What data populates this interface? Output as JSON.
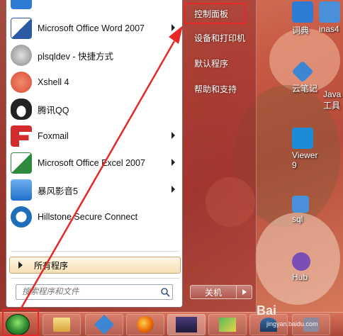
{
  "desktop": {
    "icons": [
      {
        "label": "词典",
        "color": "#2e7bd6"
      },
      {
        "label": "inas4",
        "color": "#4a90d9"
      },
      {
        "label": "云笔记",
        "color": "#3d86d4"
      },
      {
        "label": "Java",
        "color": "#2c5f9a"
      },
      {
        "label": "工具",
        "color": "#2c5f9a"
      },
      {
        "label": "Viewer",
        "color": "#1e8bd8"
      },
      {
        "label": "9",
        "color": "#1e8bd8"
      },
      {
        "label": "sql",
        "color": "#4a90d9"
      },
      {
        "label": "Hub",
        "color": "#7a4fb5"
      }
    ]
  },
  "start_menu": {
    "pinned": [
      {
        "label": "Microsoft Office Word 2007",
        "icon": "word-icon",
        "color": "#2b5aa5",
        "has_arrow": true
      },
      {
        "label": "plsqldev - 快捷方式",
        "icon": "database-icon",
        "color": "#888888",
        "has_arrow": false
      },
      {
        "label": "Xshell 4",
        "icon": "xshell-icon",
        "color": "#d94a3a",
        "has_arrow": false
      },
      {
        "label": "腾讯QQ",
        "icon": "qq-penguin-icon",
        "color": "#222222",
        "has_arrow": false
      },
      {
        "label": "Foxmail",
        "icon": "foxmail-icon",
        "color": "#d32c2c",
        "has_arrow": true
      },
      {
        "label": "Microsoft Office Excel 2007",
        "icon": "excel-icon",
        "color": "#2e8b3d",
        "has_arrow": true
      },
      {
        "label": "暴风影音5",
        "icon": "media-player-icon",
        "color": "#1f6fc9",
        "has_arrow": true
      },
      {
        "label": "Hillstone Secure Connect",
        "icon": "hillstone-icon",
        "color": "#1e6db8",
        "has_arrow": false
      }
    ],
    "all_programs": "所有程序",
    "search_placeholder": "搜索程序和文件",
    "right_items": [
      "控制面板",
      "设备和打印机",
      "默认程序",
      "帮助和支持"
    ],
    "shutdown_label": "关机"
  },
  "taskbar": {
    "apps": [
      "explorer-icon",
      "pen-app-icon",
      "firefox-icon",
      "media-app-icon",
      "paint-app-icon",
      "sql-app-icon",
      "tool-app-icon"
    ]
  },
  "watermark": {
    "brand": "Bai",
    "sub": "jingyan.baidu.com"
  },
  "colors": {
    "highlight_frame": "#e62828",
    "menu_white": "#ffffff"
  }
}
